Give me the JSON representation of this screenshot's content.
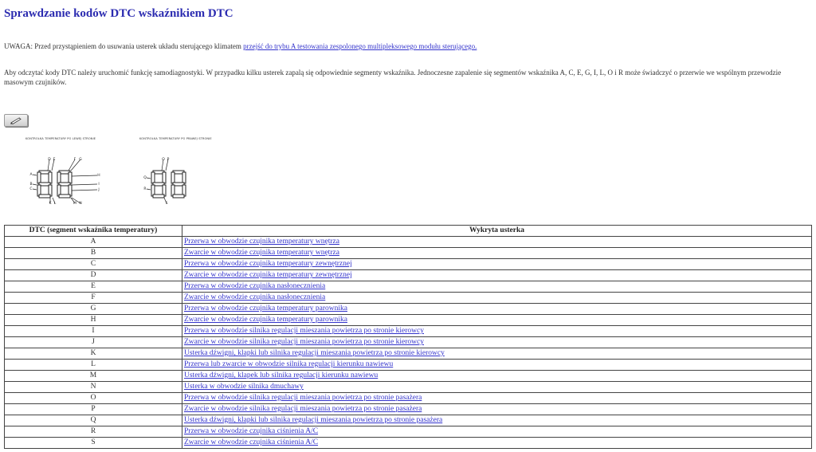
{
  "title": "Sprawdzanie kodów DTC wskaźnikiem DTC",
  "warning": {
    "text": "UWAGA: Przed przystąpieniem do usuwania usterek układu sterującego klimatem ",
    "link": "przejść do trybu A testowania zespolonego multipleksowego modułu sterującego."
  },
  "info": "Aby odczytać kody DTC należy uruchomić funkcję samodiagnostyki. W przypadku kilku usterek zapalą się odpowiednie segmenty wskaźnika. Jednoczesne zapalenie się segmentów wskaźnika A, C, E, G, I, L, O i R może świadczyć o przerwie we wspólnym przewodzie masowym czujników.",
  "toolbar": {
    "icon": "pencil-icon"
  },
  "diagrams": {
    "left_caption": "KONTROLKA TEMPERATURY PO LEWEJ STRONIE",
    "right_caption": "KONTROLKA TEMPERATURY PO PRAWEJ STRONIE",
    "left_labels": [
      "A",
      "B",
      "C",
      "D",
      "E",
      "F",
      "G",
      "H",
      "I",
      "J",
      "K",
      "L",
      "M",
      "N"
    ],
    "right_labels": [
      "O",
      "P",
      "Q",
      "R",
      "S"
    ]
  },
  "table": {
    "headers": [
      "DTC (segment wskaźnika temperatury)",
      "Wykryta usterka"
    ],
    "rows": [
      [
        "A",
        "Przerwa w obwodzie czujnika temperatury wnętrza"
      ],
      [
        "B",
        "Zwarcie w obwodzie czujnika temperatury wnętrza"
      ],
      [
        "C",
        "Przerwa w obwodzie czujnika temperatury zewnętrznej"
      ],
      [
        "D",
        "Zwarcie w obwodzie czujnika temperatury zewnętrznej"
      ],
      [
        "E",
        "Przerwa w obwodzie czujnika nasłonecznienia"
      ],
      [
        "F",
        "Zwarcie w obwodzie czujnika nasłonecznienia"
      ],
      [
        "G",
        "Przerwa w obwodzie czujnika temperatury parownika"
      ],
      [
        "H",
        "Zwarcie w obwodzie czujnika temperatury parownika"
      ],
      [
        "I",
        "Przerwa w obwodzie silnika regulacji mieszania powietrza po stronie kierowcy"
      ],
      [
        "J",
        "Zwarcie w obwodzie silnika regulacji mieszania powietrza po stronie kierowcy"
      ],
      [
        "K",
        "Usterka dźwigni, klapki lub silnika regulacji mieszania powietrza po stronie kierowcy"
      ],
      [
        "L",
        "Przerwa lub zwarcie w obwodzie silnika regulacji kierunku nawiewu"
      ],
      [
        "M",
        "Usterka dźwigni, klapek lub silnika regulacji kierunku nawiewu"
      ],
      [
        "N",
        "Usterka w obwodzie silnika dmuchawy"
      ],
      [
        "O",
        "Przerwa w obwodzie silnika regulacji mieszania powietrza po stronie pasażera"
      ],
      [
        "P",
        "Zwarcie w obwodzie silnika regulacji mieszania powietrza po stronie pasażera"
      ],
      [
        "Q",
        "Usterka dźwigni, klapki lub silnika regulacji mieszania powietrza po stronie pasażera"
      ],
      [
        "R",
        "Przerwa w obwodzie czujnika ciśnienia A/C"
      ],
      [
        "S",
        "Zwarcie w obwodzie czujnika ciśnienia A/C"
      ]
    ]
  }
}
